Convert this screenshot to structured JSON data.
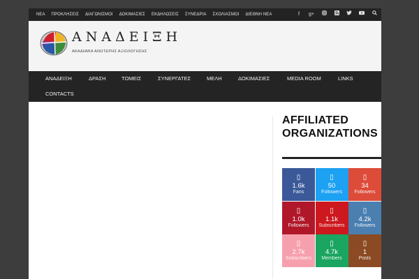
{
  "topnav": [
    "ΝΕΑ",
    "ΠΡΟΚΛΗΣΕΙΣ",
    "ΔΙΑΓΩΝΙΣΜΟΙ",
    "ΔΟΚΙΜΑΣΙΕΣ",
    "ΕΚΔΗΛΩΣΕΙΣ",
    "ΣΥΝΕΔΡΙΑ",
    "ΣΧΟΛΙΑΣΜΟΙ",
    "ΔΙΕΘΝΗ ΝΕΑ"
  ],
  "topicons": [
    "facebook-icon",
    "google-plus-icon",
    "instagram-icon",
    "rss-icon",
    "twitter-icon",
    "youtube-icon",
    "search-icon"
  ],
  "logo": {
    "title": "ΑΝΑΔΕΙΞΗ",
    "subtitle": "ΑΚΑΔΗΜΙΑ ΑΝΩΤΕΡΗΣ ΑΞΙΟΛΟΓΗΣΗΣ"
  },
  "mainnav": [
    "ΑΝΑΔΕΙΞΗ",
    "ΔΡΑΣΗ",
    "ΤΟΜΕΙΣ",
    "ΣΥΝΕΡΓΑΤΕΣ",
    "ΜΕΛΗ",
    "ΔΟΚΙΜΑΣΙΕΣ",
    "MEDIA ROOM",
    "LINKS",
    "CONTACTS"
  ],
  "sidebar": {
    "title": "AFFILIATED ORGANIZATIONS",
    "counters": [
      {
        "icon": "facebook-icon",
        "count": "1.6k",
        "label": "Fans",
        "color": "#3b5998"
      },
      {
        "icon": "twitter-icon",
        "count": "50",
        "label": "Followers",
        "color": "#1da1f2"
      },
      {
        "icon": "google-plus-icon",
        "count": "34",
        "label": "Followers",
        "color": "#dd4b39"
      },
      {
        "icon": "pinterest-icon",
        "count": "1.0k",
        "label": "Followers",
        "color": "#b0182a"
      },
      {
        "icon": "youtube-icon",
        "count": "1.1k",
        "label": "Subscribers",
        "color": "#cc181e"
      },
      {
        "icon": "vimeo-icon",
        "count": "4.2k",
        "label": "Followers",
        "color": "#4a7fb0"
      },
      {
        "icon": "dribbble-icon",
        "count": "2.7k",
        "label": "Subscribers",
        "color": "#f7a0ad"
      },
      {
        "icon": "members-icon",
        "count": "4.7k",
        "label": "Members",
        "color": "#1aa560"
      },
      {
        "icon": "posts-icon",
        "count": "1",
        "label": "Posts",
        "color": "#8b4a23"
      }
    ]
  }
}
